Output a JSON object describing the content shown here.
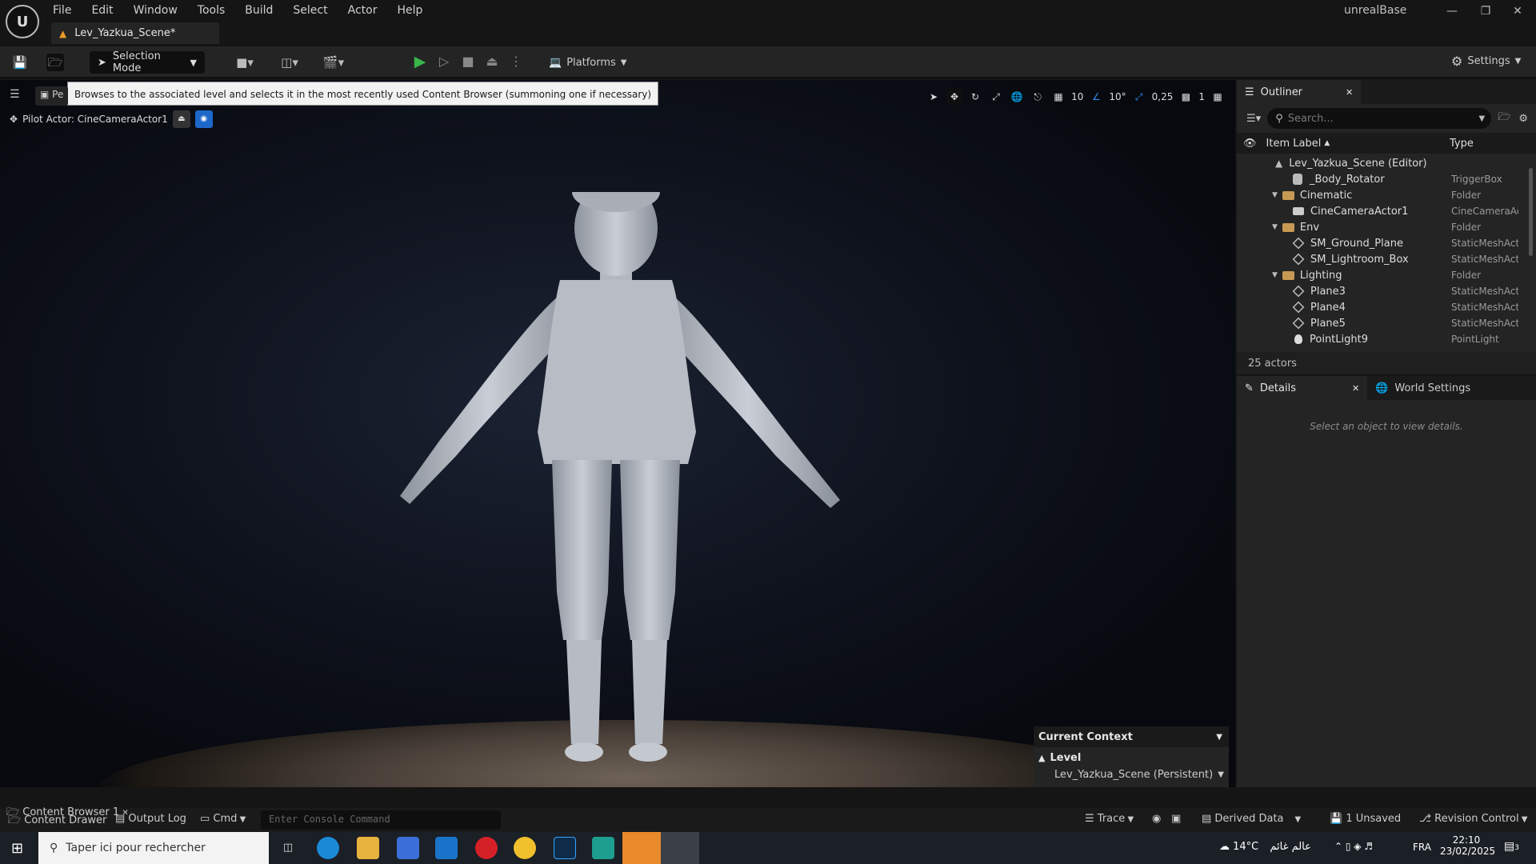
{
  "app": {
    "project_name": "unrealBase",
    "tab_label": "Lev_Yazkua_Scene*",
    "menu": [
      "File",
      "Edit",
      "Window",
      "Tools",
      "Build",
      "Select",
      "Actor",
      "Help"
    ]
  },
  "toolbar": {
    "selection_mode": "Selection Mode",
    "platforms": "Platforms",
    "settings": "Settings"
  },
  "viewport": {
    "tooltip": "Browses to the associated level and selects it in the most recently used Content Browser (summoning one if necessary)",
    "pilot_label": "Pilot Actor: CineCameraActor1",
    "view_mode_prefix": "Pe",
    "grid_value": "10",
    "angle_value": "10°",
    "scale_value": "0,25",
    "camera_speed": "1"
  },
  "context": {
    "title": "Current Context",
    "level_label": "Level",
    "level_value": "Lev_Yazkua_Scene (Persistent)"
  },
  "outliner": {
    "tab": "Outliner",
    "search_placeholder": "Search...",
    "col_label": "Item Label",
    "col_type": "Type",
    "rows": [
      {
        "label": "Lev_Yazkua_Scene (Editor)",
        "type": ""
      },
      {
        "label": "_Body_Rotator",
        "type": "TriggerBox"
      },
      {
        "label": "Cinematic",
        "type": "Folder"
      },
      {
        "label": "CineCameraActor1",
        "type": "CineCameraAc"
      },
      {
        "label": "Env",
        "type": "Folder"
      },
      {
        "label": "SM_Ground_Plane",
        "type": "StaticMeshActo"
      },
      {
        "label": "SM_Lightroom_Box",
        "type": "StaticMeshActo"
      },
      {
        "label": "Lighting",
        "type": "Folder"
      },
      {
        "label": "Plane3",
        "type": "StaticMeshActo"
      },
      {
        "label": "Plane4",
        "type": "StaticMeshActo"
      },
      {
        "label": "Plane5",
        "type": "StaticMeshActo"
      },
      {
        "label": "PointLight9",
        "type": "PointLight"
      }
    ],
    "actor_count": "25 actors"
  },
  "details": {
    "tab": "Details",
    "world_tab": "World Settings",
    "empty_message": "Select an object to view details."
  },
  "bottom": {
    "content_browser": "Content Browser 1",
    "content_drawer": "Content Drawer",
    "output_log": "Output Log",
    "cmd": "Cmd",
    "console_placeholder": "Enter Console Command",
    "trace": "Trace",
    "derived_data": "Derived Data",
    "unsaved": "1 Unsaved",
    "revision_control": "Revision Control"
  },
  "taskbar": {
    "search_placeholder": "Taper ici pour rechercher",
    "weather": "14°C",
    "weather_text": "عالم غائم",
    "lang": "FRA",
    "time": "22:10",
    "date": "23/02/2025",
    "notif_count": "3"
  }
}
